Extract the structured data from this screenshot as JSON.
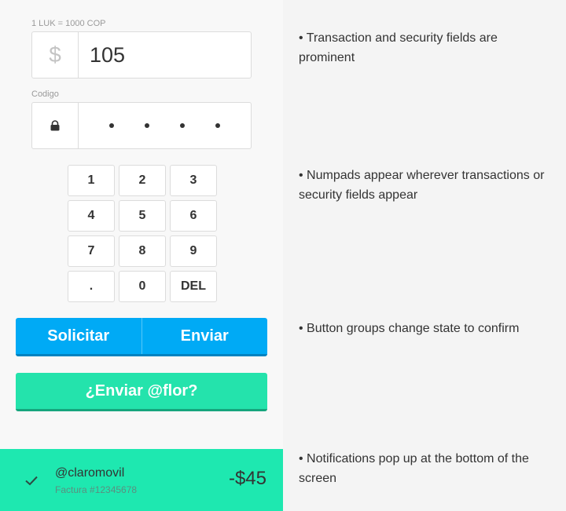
{
  "transaction": {
    "rate_label": "1 LUK = 1000 COP",
    "currency_symbol": "$",
    "amount_value": "105"
  },
  "security": {
    "code_label": "Codigo",
    "pin_length": 4
  },
  "numpad": {
    "keys": [
      "1",
      "2",
      "3",
      "4",
      "5",
      "6",
      "7",
      "8",
      "9",
      ".",
      "0",
      "DEL"
    ]
  },
  "button_group": {
    "request_label": "Solicitar",
    "send_label": "Enviar"
  },
  "confirm_button": {
    "label": "¿Enviar @flor?"
  },
  "notification": {
    "user": "@claromovil",
    "subtitle": "Factura #12345678",
    "amount": "-$45"
  },
  "notes": [
    "• Transaction and security fields are prominent",
    "• Numpads appear wherever transactions or security fields appear",
    "• Button groups change state to confirm",
    "• Notifications pop up at the bottom of the screen"
  ],
  "colors": {
    "primary_blue": "#00aaf5",
    "confirm_green": "#24e3ac",
    "notification_green": "#1ee8b0"
  }
}
